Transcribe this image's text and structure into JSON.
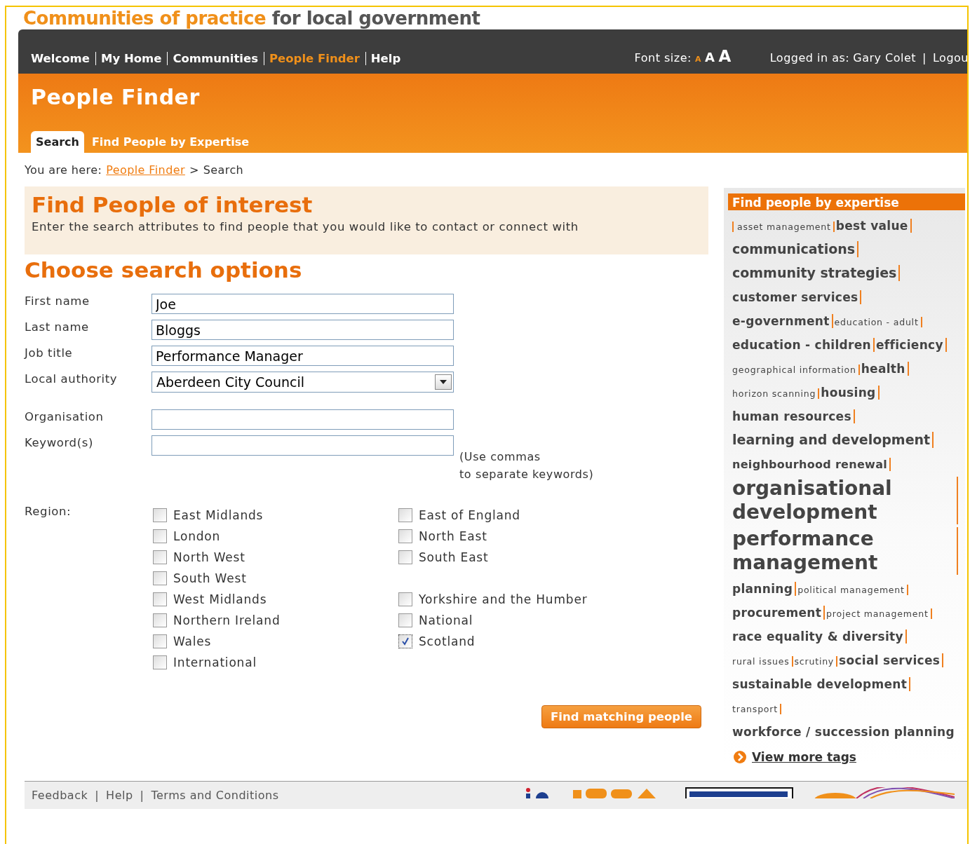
{
  "site_title": {
    "highlight": "Communities of practice",
    "rest": "for local government"
  },
  "nav": {
    "items": [
      {
        "label": "Welcome",
        "selected": false
      },
      {
        "label": "My Home",
        "selected": false
      },
      {
        "label": "Communities",
        "selected": false
      },
      {
        "label": "People Finder",
        "selected": true
      },
      {
        "label": "Help",
        "selected": false
      }
    ],
    "font_size_label": "Font size:",
    "font_sizes": [
      {
        "label": "A",
        "selected": true
      },
      {
        "label": "A",
        "selected": false
      },
      {
        "label": "A",
        "selected": false
      }
    ],
    "logged_in_label": "Logged in as:",
    "user": "Gary Colet",
    "separator": "|",
    "logout": "Logou"
  },
  "header": {
    "title": "People Finder",
    "tabs": [
      {
        "label": "Search",
        "selected": true
      },
      {
        "label": "Find People by Expertise",
        "selected": false
      }
    ]
  },
  "breadcrumb": {
    "prefix": "You are here:",
    "link": "People Finder",
    "separator": ">",
    "current": "Search"
  },
  "intro": {
    "title": "Find People of interest",
    "text": "Enter the search attributes to find people that you would like to contact or connect with"
  },
  "form": {
    "title": "Choose search options",
    "fields": [
      {
        "label": "First name",
        "kind": "text",
        "value": "Joe"
      },
      {
        "label": "Last name",
        "kind": "text",
        "value": "Bloggs"
      },
      {
        "label": "Job title",
        "kind": "text",
        "value": "Performance Manager"
      },
      {
        "label": "Local authority",
        "kind": "select",
        "value": "Aberdeen City Council"
      },
      {
        "label": "Organisation",
        "kind": "text"
      },
      {
        "label": "Keyword(s)",
        "kind": "text",
        "hint": [
          "(Use commas",
          "to separate keywords)"
        ]
      }
    ],
    "region_label": "Region:",
    "region_rows": [
      {
        "left": {
          "label": "East Midlands",
          "checked": false
        },
        "right": {
          "label": "East of England",
          "checked": false
        }
      },
      {
        "left": {
          "label": "London",
          "checked": false
        },
        "right": {
          "label": "North East",
          "checked": false
        }
      },
      {
        "left": {
          "label": "North West",
          "checked": false
        },
        "right": {
          "label": "South East",
          "checked": false
        }
      },
      {
        "left": {
          "label": "South West",
          "checked": false
        }
      },
      {
        "left": {
          "label": "West Midlands",
          "checked": false
        },
        "right": {
          "label": "Yorkshire and the Humber",
          "checked": false
        }
      },
      {
        "left": {
          "label": "Northern Ireland",
          "checked": false
        },
        "right": {
          "label": "National",
          "checked": false
        }
      },
      {
        "left": {
          "label": "Wales",
          "checked": false
        },
        "right": {
          "label": "Scotland",
          "checked": true
        }
      },
      {
        "left": {
          "label": "International",
          "checked": false
        }
      }
    ],
    "submit": "Find matching people"
  },
  "sidebar": {
    "title": "Find people by expertise",
    "tags": [
      {
        "label": "asset management",
        "kind": "tiny",
        "separator": true
      },
      {
        "label": "best value",
        "kind": "medium",
        "separator": true
      },
      {
        "label": "communications",
        "kind": "large",
        "separator": true
      },
      {
        "label": "community strategies",
        "kind": "large",
        "separator": true
      },
      {
        "label": "customer services",
        "kind": "medium",
        "separator": true
      },
      {
        "label": "e-government",
        "kind": "medium",
        "separator": true
      },
      {
        "label": "education - adult",
        "kind": "tiny",
        "separator": true
      },
      {
        "label": "education - children",
        "kind": "medium",
        "separator": true
      },
      {
        "label": "efficiency",
        "kind": "medium",
        "separator": true
      },
      {
        "label": "geographical information",
        "kind": "tiny",
        "separator": true
      },
      {
        "label": "health",
        "kind": "medium",
        "separator": true
      },
      {
        "label": "horizon scanning",
        "kind": "tiny",
        "separator": true
      },
      {
        "label": "housing",
        "kind": "medium",
        "separator": true
      },
      {
        "label": "human resources",
        "kind": "medium",
        "separator": true
      },
      {
        "label": "learning and development",
        "kind": "large",
        "separator": true
      },
      {
        "label": "neighbourhood renewal",
        "kind": "small",
        "separator": true
      },
      {
        "label": "organisational development",
        "kind": "huge",
        "separator": true
      },
      {
        "label": "performance management",
        "kind": "huge",
        "separator": true
      },
      {
        "label": "planning",
        "kind": "medium",
        "separator": true
      },
      {
        "label": "political management",
        "kind": "tiny",
        "separator": true
      },
      {
        "label": "procurement",
        "kind": "medium",
        "separator": true
      },
      {
        "label": "project management",
        "kind": "tiny",
        "separator": true
      },
      {
        "label": "race equality & diversity",
        "kind": "medium",
        "separator": true
      },
      {
        "label": "rural issues",
        "kind": "tiny",
        "separator": true
      },
      {
        "label": "scrutiny",
        "kind": "tiny",
        "separator": true
      },
      {
        "label": "social services",
        "kind": "medium",
        "separator": true
      },
      {
        "label": "sustainable development",
        "kind": "medium",
        "separator": true
      },
      {
        "label": "transport",
        "kind": "tiny",
        "separator": true
      },
      {
        "label": "workforce / succession planning",
        "kind": "medium",
        "separator": false
      }
    ],
    "more": "View more tags"
  },
  "footer": {
    "links": [
      "Feedback",
      "Help",
      "Terms and Conditions"
    ],
    "separator": "|"
  }
}
